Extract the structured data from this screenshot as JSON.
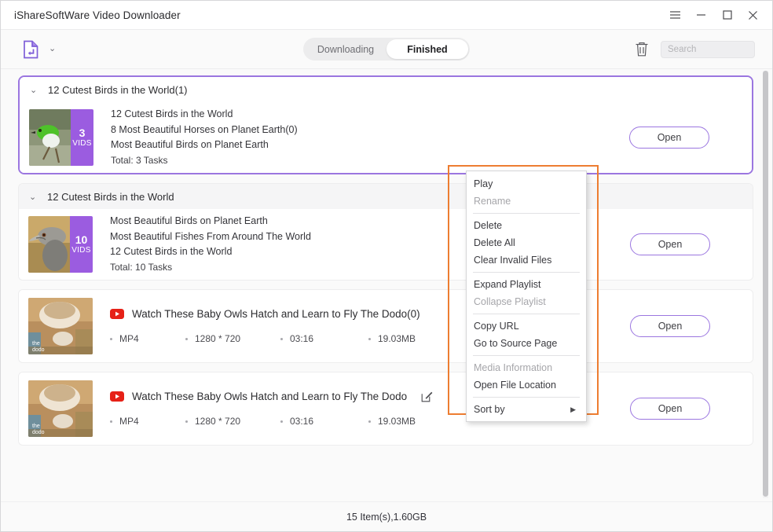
{
  "window": {
    "title": "iShareSoftWare Video Downloader",
    "controls": [
      {
        "name": "menu-button",
        "glyph": "hamburger"
      },
      {
        "name": "minimize-button",
        "glyph": "minimize"
      },
      {
        "name": "maximize-button",
        "glyph": "maximize"
      },
      {
        "name": "close-button",
        "glyph": "close"
      }
    ]
  },
  "toolbar": {
    "logo_icon": "download-file-icon",
    "logo_caret": "⌄",
    "trash_icon": "trash-icon",
    "tabs": [
      {
        "label": "Downloading",
        "active": false
      },
      {
        "label": "Finished",
        "active": true
      }
    ],
    "search": {
      "placeholder": "Search",
      "value": ""
    }
  },
  "groups": [
    {
      "selected": true,
      "shaded_header": false,
      "caret": "⌄",
      "title": "12 Cutest Birds in the World(1)",
      "type": "playlist",
      "count": "3",
      "count_unit": "VIDS",
      "lines": [
        "12 Cutest Birds in the World",
        "8 Most Beautiful Horses on Planet Earth(0)",
        "Most Beautiful Birds on Planet Earth"
      ],
      "total": "Total: 3 Tasks",
      "open_label": "Open"
    },
    {
      "selected": false,
      "shaded_header": true,
      "caret": "⌄",
      "title": "12 Cutest Birds in the World",
      "type": "playlist",
      "count": "10",
      "count_unit": "VIDS",
      "lines": [
        "Most Beautiful Birds on Planet Earth",
        "Most Beautiful Fishes From Around The World",
        "12 Cutest Birds in the World"
      ],
      "total": "Total: 10 Tasks",
      "open_label": "Open"
    }
  ],
  "videos": [
    {
      "source_icon": "youtube-icon",
      "title": "Watch These Baby Owls Hatch and Learn to Fly  The Dodo(0)",
      "has_edit_icon": false,
      "meta": [
        "MP4",
        "1280 * 720",
        "03:16",
        "19.03MB"
      ],
      "open_label": "Open"
    },
    {
      "source_icon": "youtube-icon",
      "title": "Watch These Baby Owls Hatch and Learn to Fly  The Dodo",
      "has_edit_icon": true,
      "edit_icon": "edit-icon",
      "meta": [
        "MP4",
        "1280 * 720",
        "03:16",
        "19.03MB"
      ],
      "open_label": "Open"
    }
  ],
  "context_menu": {
    "highlighted": true,
    "highlight_color": "#ed7d31",
    "sections": [
      [
        {
          "label": "Play",
          "disabled": false
        },
        {
          "label": "Rename",
          "disabled": true
        }
      ],
      [
        {
          "label": "Delete",
          "disabled": false
        },
        {
          "label": "Delete All",
          "disabled": false
        },
        {
          "label": "Clear Invalid Files",
          "disabled": false
        }
      ],
      [
        {
          "label": "Expand Playlist",
          "disabled": false
        },
        {
          "label": "Collapse Playlist",
          "disabled": true
        }
      ],
      [
        {
          "label": "Copy URL",
          "disabled": false
        },
        {
          "label": "Go to Source Page",
          "disabled": false
        }
      ],
      [
        {
          "label": "Media Information",
          "disabled": true
        },
        {
          "label": "Open File Location",
          "disabled": false
        }
      ],
      [
        {
          "label": "Sort by",
          "disabled": false,
          "submenu": true,
          "arrow": "▶"
        }
      ]
    ]
  },
  "footer": {
    "status": "15 Item(s),1.60GB"
  },
  "colors": {
    "accent_purple": "#9b5ce0",
    "border_purple": "#9b76e0",
    "highlight_orange": "#ed7d31",
    "youtube_red": "#e62117"
  }
}
